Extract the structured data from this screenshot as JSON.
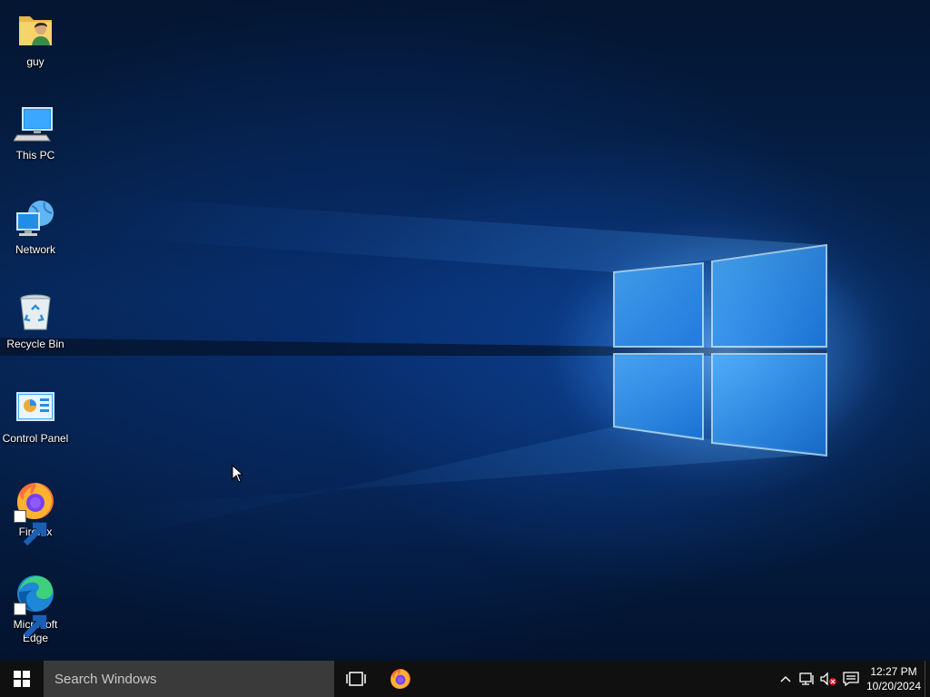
{
  "desktop": {
    "icons": [
      {
        "label": "guy",
        "icon": "user-folder-icon"
      },
      {
        "label": "This PC",
        "icon": "computer-icon"
      },
      {
        "label": "Network",
        "icon": "network-icon"
      },
      {
        "label": "Recycle Bin",
        "icon": "recycle-bin-icon"
      },
      {
        "label": "Control Panel",
        "icon": "control-panel-icon"
      },
      {
        "label": "Firefox",
        "icon": "firefox-icon",
        "shortcut": true
      },
      {
        "label": "Microsoft Edge",
        "icon": "edge-icon",
        "shortcut": true
      }
    ]
  },
  "taskbar": {
    "search_placeholder": "Search Windows",
    "pinned": [
      "task-view-icon",
      "firefox-icon"
    ],
    "tray": [
      "chevron-up-icon",
      "network-icon",
      "volume-muted-icon",
      "action-center-icon"
    ],
    "time": "12:27 PM",
    "date": "10/20/2024"
  },
  "colors": {
    "taskbar": "#101010",
    "search_box": "#3a3a3a",
    "accent": "#2a9bff"
  }
}
